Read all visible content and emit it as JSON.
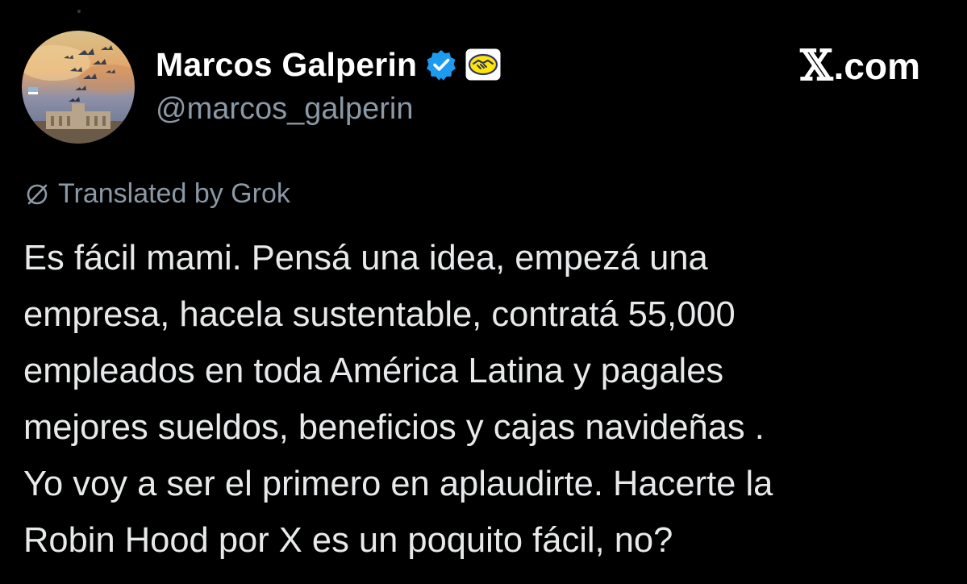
{
  "author": {
    "display_name": "Marcos Galperin",
    "handle": "@marcos_galperin",
    "avatar_icon": "avatar-birds-sunset",
    "verified_icon": "verified-badge-icon",
    "affiliate_icon": "mercado-libre-handshake-icon"
  },
  "site_label": {
    "x_mark": "𝕏",
    "suffix": ".com"
  },
  "translation": {
    "icon": "grok-slash-circle-icon",
    "label": "Translated by Grok"
  },
  "post": {
    "lines": [
      "Es fácil mami. Pensá una idea, empezá una",
      "empresa, hacela sustentable, contratá 55,000",
      "empleados en toda América Latina y pagales",
      "mejores sueldos, beneficios y cajas navideñas .",
      "Yo voy a ser el primero en aplaudirte. Hacerte la",
      "Robin Hood por X es un poquito fácil, no?"
    ]
  },
  "colors": {
    "background": "#000000",
    "name": "#ffffff",
    "secondary": "#8b98a5",
    "body_text": "#e7e9ea",
    "verified_blue": "#1d9bf0",
    "affiliate_yellow": "#ffe600"
  }
}
